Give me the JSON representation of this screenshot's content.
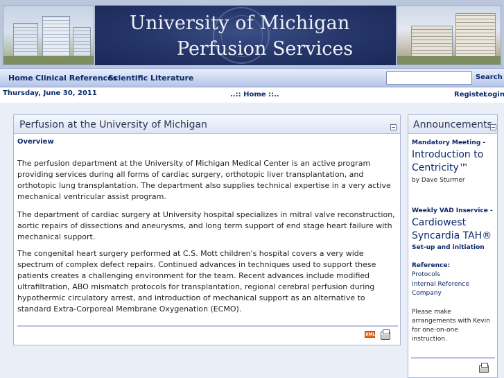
{
  "banner": {
    "title_line1": "University of Michigan",
    "title_line2": "Perfusion Services"
  },
  "nav": {
    "items": [
      "Home",
      "Clinical References",
      "Scientific Literature"
    ],
    "search_value": "",
    "search_button": "Search"
  },
  "infobar": {
    "date": "Thursday, June 30, 2011",
    "breadcrumb": "..:: Home ::..",
    "register": "Register",
    "login": "Login"
  },
  "main": {
    "title": "Perfusion at the University of Michigan",
    "overview_label": "Overview",
    "paragraphs": [
      "The perfusion department at the University of Michigan Medical Center is an active program providing services during all forms of cardiac surgery, orthotopic liver transplantation, and orthotopic lung transplantation. The department also supplies technical expertise in a very active mechanical ventricular assist program.",
      "The department of cardiac surgery at University hospital specializes in mitral valve reconstruction, aortic repairs of dissections and aneurysms, and long term support of end stage heart failure with mechanical support.",
      "The congenital heart surgery performed at C.S. Mott children's hospital covers a very wide spectrum of complex defect repairs. Continued advances in techniques used to support these patients creates a challenging environment for the team. Recent advances include modified ultrafiltration, ABO mismatch protocols for transplantation, regional cerebral perfusion during hypothermic circulatory arrest, and introduction of mechanical support as an alternative to standard Extra-Corporeal Membrane Oxygenation (ECMO)."
    ],
    "xml_label": "XML"
  },
  "announcements": {
    "title": "Announcements",
    "item1_head": "Mandatory Meeting -",
    "item1_title": "Introduction to Centricity™",
    "item1_by": "by Dave Sturmer",
    "item2_head": "Weekly VAD Inservice -",
    "item2_title": "Cardiowest Syncardia TAH®",
    "item2_sub": "Set-up and initiation",
    "ref_head": "Reference:",
    "ref_links": [
      "Protocols",
      "Internal Reference",
      "Company"
    ],
    "note": "Please make arrangements with Kevin for one-on-one instruction."
  },
  "colors": {
    "nav_text": "#0b2a6b",
    "banner_bg": "#1b2858",
    "content_bg": "#e9eef7"
  }
}
